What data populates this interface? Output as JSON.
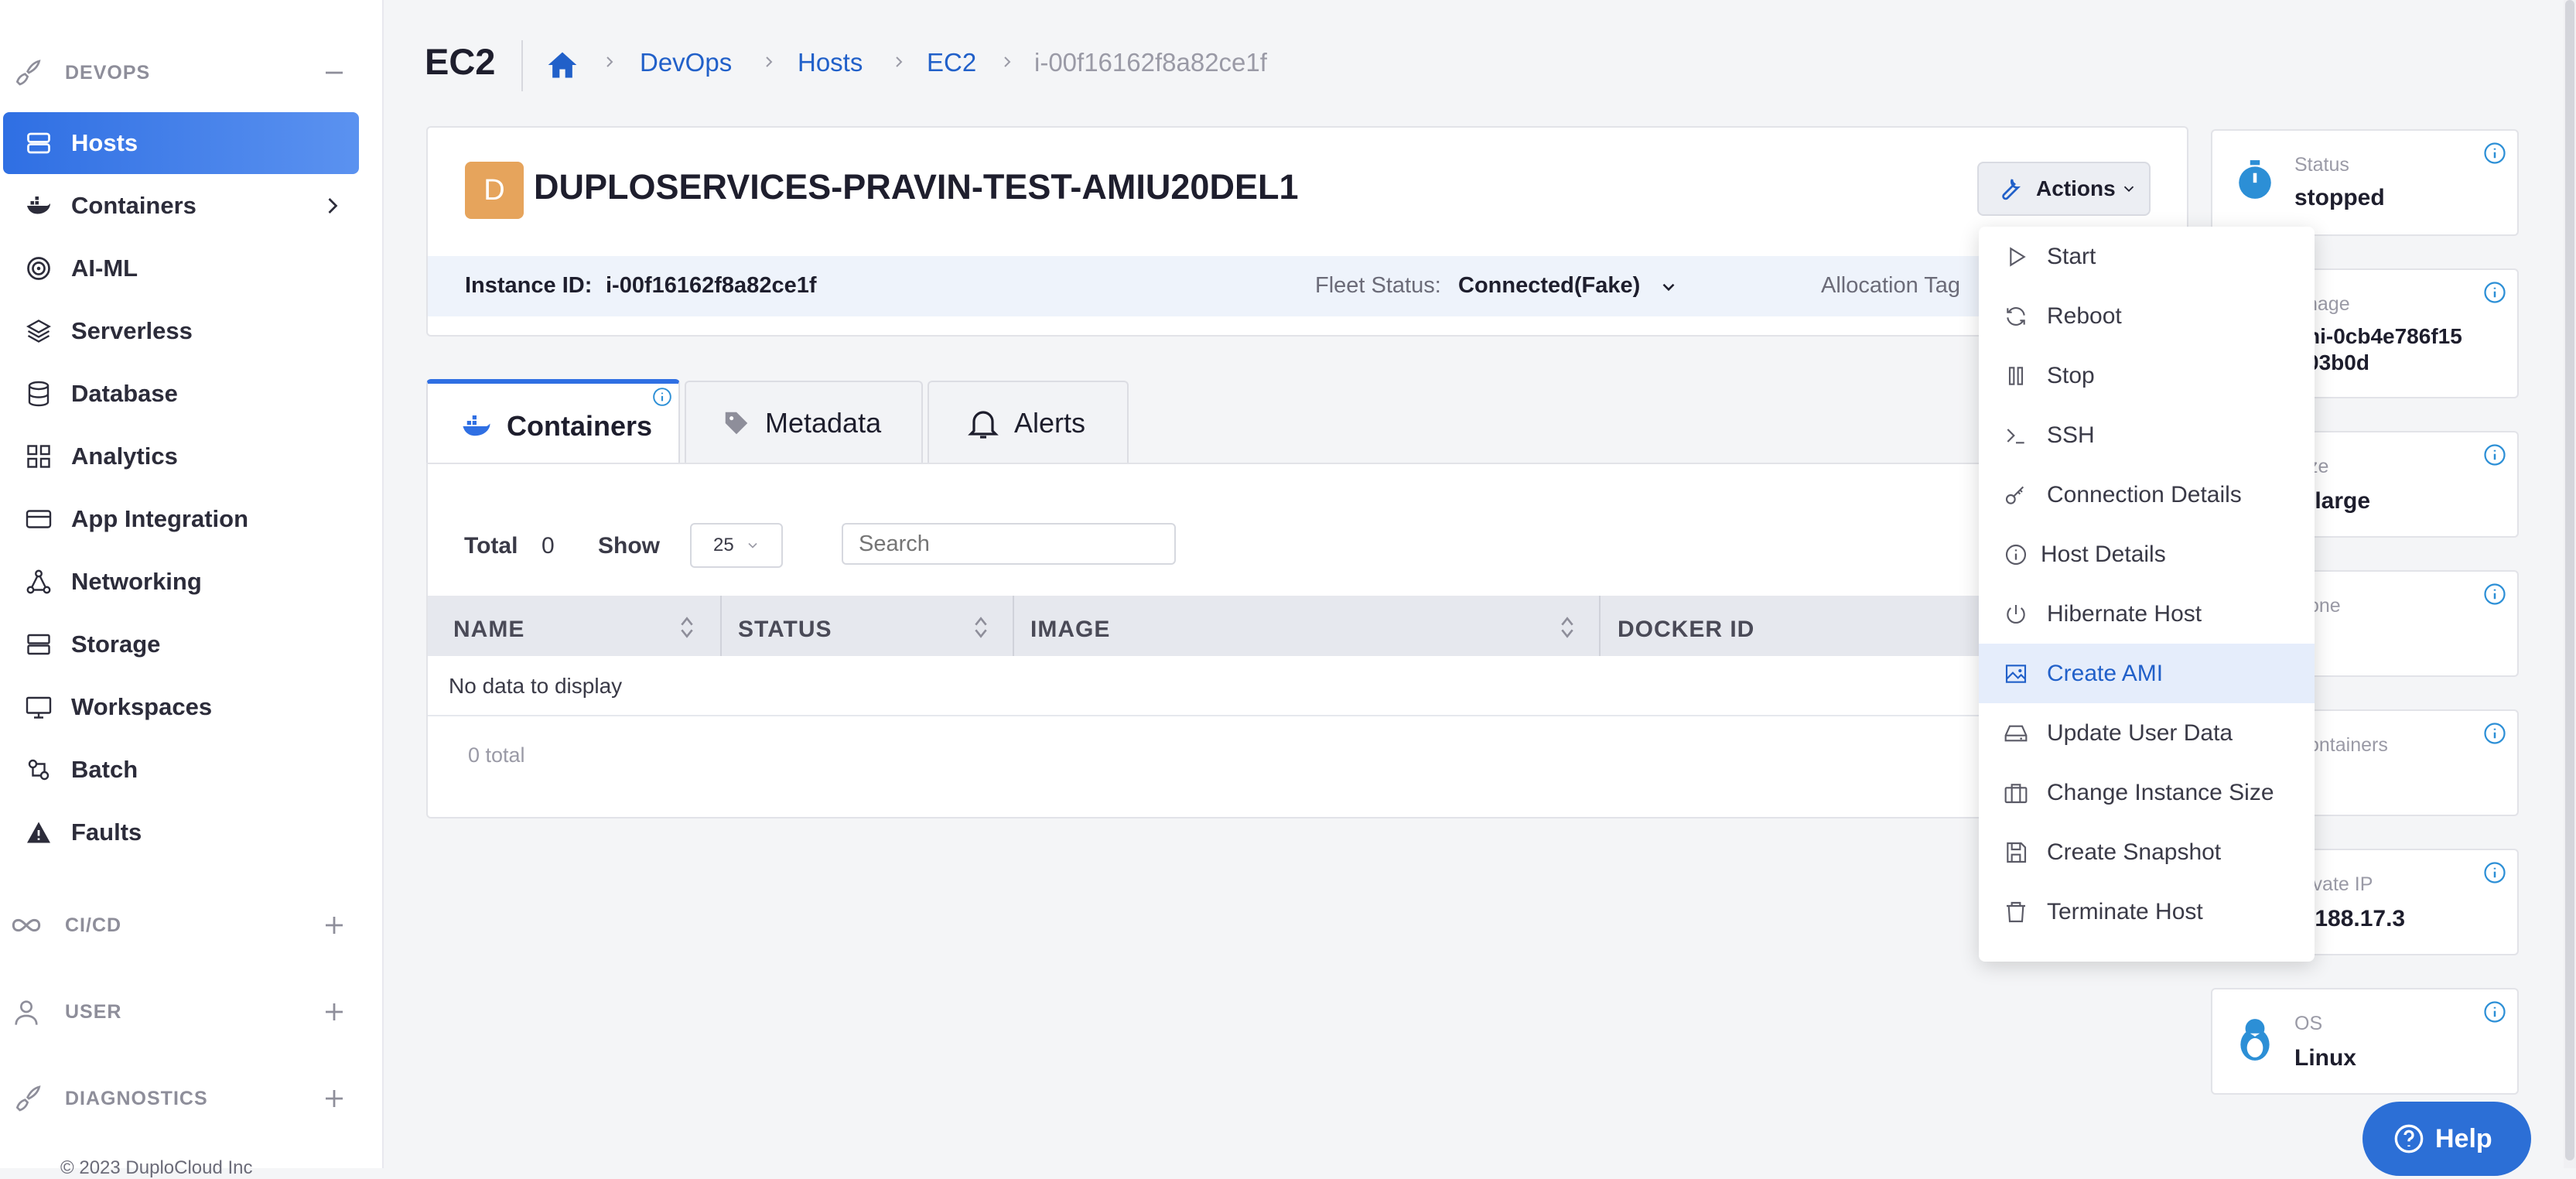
{
  "sidebar": {
    "sections": [
      {
        "label": "DEVOPS",
        "toggle": "−"
      },
      {
        "label": "CI/CD",
        "toggle": "+"
      },
      {
        "label": "USER",
        "toggle": "+"
      },
      {
        "label": "DIAGNOSTICS",
        "toggle": "+"
      }
    ],
    "items": [
      {
        "label": "Hosts",
        "icon": "server-icon",
        "active": true
      },
      {
        "label": "Containers",
        "icon": "docker-icon",
        "has_children": true
      },
      {
        "label": "AI-ML",
        "icon": "target-icon"
      },
      {
        "label": "Serverless",
        "icon": "layers-icon"
      },
      {
        "label": "Database",
        "icon": "database-icon"
      },
      {
        "label": "Analytics",
        "icon": "grid-icon"
      },
      {
        "label": "App Integration",
        "icon": "card-icon"
      },
      {
        "label": "Networking",
        "icon": "network-icon"
      },
      {
        "label": "Storage",
        "icon": "storage-icon"
      },
      {
        "label": "Workspaces",
        "icon": "monitor-icon"
      },
      {
        "label": "Batch",
        "icon": "batch-icon"
      },
      {
        "label": "Faults",
        "icon": "warning-icon"
      }
    ],
    "footer": "© 2023 DuploCloud Inc"
  },
  "header": {
    "title": "EC2",
    "breadcrumbs": [
      "DevOps",
      "Hosts",
      "EC2",
      "i-00f16162f8a82ce1f"
    ]
  },
  "host": {
    "avatar_letter": "D",
    "name": "DUPLOSERVICES-PRAVIN-TEST-AMIU20DEL1",
    "instance_id_label": "Instance ID:",
    "instance_id": "i-00f16162f8a82ce1f",
    "fleet_status_label": "Fleet Status:",
    "fleet_status": "Connected(Fake)",
    "allocation_tag_label": "Allocation Tag",
    "actions_label": "Actions"
  },
  "tabs": [
    {
      "label": "Containers",
      "icon": "docker-icon",
      "active": true
    },
    {
      "label": "Metadata",
      "icon": "tag-icon"
    },
    {
      "label": "Alerts",
      "icon": "bell-icon"
    }
  ],
  "table": {
    "total_label": "Total",
    "total_value": "0",
    "show_label": "Show",
    "page_size": "25",
    "search_placeholder": "Search",
    "columns": [
      "NAME",
      "STATUS",
      "IMAGE",
      "DOCKER ID"
    ],
    "empty_text": "No data to display",
    "footer_total": "0 total"
  },
  "actions_menu": [
    {
      "label": "Start",
      "icon": "play-icon"
    },
    {
      "label": "Reboot",
      "icon": "refresh-icon"
    },
    {
      "label": "Stop",
      "icon": "pause-icon"
    },
    {
      "label": "SSH",
      "icon": "terminal-icon"
    },
    {
      "label": "Connection Details",
      "icon": "key-icon"
    },
    {
      "label": "Host Details",
      "icon": "info-icon"
    },
    {
      "label": "Hibernate Host",
      "icon": "power-icon"
    },
    {
      "label": "Create AMI",
      "icon": "image-icon",
      "highlighted": true
    },
    {
      "label": "Update User Data",
      "icon": "hdd-icon"
    },
    {
      "label": "Change Instance Size",
      "icon": "briefcase-icon"
    },
    {
      "label": "Create Snapshot",
      "icon": "save-icon"
    },
    {
      "label": "Terminate Host",
      "icon": "trash-icon"
    }
  ],
  "info_cards": [
    {
      "label": "Status",
      "value": "stopped"
    },
    {
      "label": "nage",
      "value": "ni-0cb4e786f15",
      "value2": "03b0d"
    },
    {
      "label": "ze",
      "value": ".large"
    },
    {
      "label": "one",
      "value": ""
    },
    {
      "label": "ontainers",
      "value": ""
    },
    {
      "label": "ivate IP",
      "value": ".188.17.3"
    },
    {
      "label": "OS",
      "value": "Linux"
    }
  ],
  "help": {
    "label": "Help"
  },
  "colors": {
    "accent": "#2f6fe3",
    "avatar": "#e6a45c",
    "help": "#2c6fd6"
  }
}
